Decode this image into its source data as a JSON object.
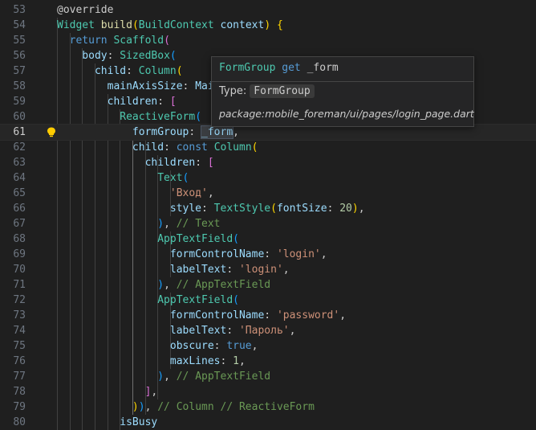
{
  "editor": {
    "active_line": 61,
    "lines": [
      {
        "n": "53",
        "t": [
          [
            "@override",
            "t-ann"
          ]
        ]
      },
      {
        "n": "54",
        "t": [
          [
            "Widget",
            "t-type"
          ],
          [
            " ",
            ""
          ],
          [
            "build",
            "t-fn"
          ],
          [
            "(",
            "t-b1"
          ],
          [
            "BuildContext",
            "t-type"
          ],
          [
            " ",
            ""
          ],
          [
            "context",
            "t-var"
          ],
          [
            ")",
            "t-b1"
          ],
          [
            " ",
            ""
          ],
          [
            "{",
            "t-b1"
          ]
        ]
      },
      {
        "n": "55",
        "t": [
          [
            "  return",
            "t-kw"
          ],
          [
            " ",
            ""
          ],
          [
            "Scaffold",
            "t-type"
          ],
          [
            "(",
            "t-b2"
          ]
        ]
      },
      {
        "n": "56",
        "t": [
          [
            "    body",
            "t-var"
          ],
          [
            ": ",
            "t-punc"
          ],
          [
            "SizedBox",
            "t-type"
          ],
          [
            "(",
            "t-b3"
          ]
        ]
      },
      {
        "n": "57",
        "t": [
          [
            "      child",
            "t-var"
          ],
          [
            ": ",
            "t-punc"
          ],
          [
            "Column",
            "t-type"
          ],
          [
            "(",
            "t-b1"
          ]
        ]
      },
      {
        "n": "58",
        "t": [
          [
            "        mainAxisSize",
            "t-var"
          ],
          [
            ": ",
            "t-punc"
          ],
          [
            "Mai",
            "t-var"
          ]
        ]
      },
      {
        "n": "59",
        "t": [
          [
            "        children",
            "t-var"
          ],
          [
            ": ",
            "t-punc"
          ],
          [
            "[",
            "t-b2"
          ]
        ]
      },
      {
        "n": "60",
        "t": [
          [
            "          ReactiveForm",
            "t-type"
          ],
          [
            "(",
            "t-b3"
          ]
        ]
      },
      {
        "n": "61",
        "t": [
          [
            "            formGroup",
            "t-var"
          ],
          [
            ": ",
            "t-punc"
          ],
          [
            "_form",
            "t-hl"
          ],
          [
            ",",
            "t-punc"
          ]
        ]
      },
      {
        "n": "62",
        "t": [
          [
            "            child",
            "t-var"
          ],
          [
            ": ",
            "t-punc"
          ],
          [
            "const",
            "t-kw"
          ],
          [
            " ",
            ""
          ],
          [
            "Column",
            "t-type"
          ],
          [
            "(",
            "t-b1"
          ]
        ]
      },
      {
        "n": "63",
        "t": [
          [
            "              children",
            "t-var"
          ],
          [
            ": ",
            "t-punc"
          ],
          [
            "[",
            "t-b2"
          ]
        ]
      },
      {
        "n": "64",
        "t": [
          [
            "                Text",
            "t-type"
          ],
          [
            "(",
            "t-b3"
          ]
        ]
      },
      {
        "n": "65",
        "t": [
          [
            "                  'Вход'",
            "t-str"
          ],
          [
            ",",
            "t-punc"
          ]
        ]
      },
      {
        "n": "66",
        "t": [
          [
            "                  style",
            "t-var"
          ],
          [
            ": ",
            "t-punc"
          ],
          [
            "TextStyle",
            "t-type"
          ],
          [
            "(",
            "t-b1"
          ],
          [
            "fontSize",
            "t-var"
          ],
          [
            ": ",
            "t-punc"
          ],
          [
            "20",
            "t-num"
          ],
          [
            ")",
            "t-b1"
          ],
          [
            ",",
            "t-punc"
          ]
        ]
      },
      {
        "n": "67",
        "t": [
          [
            "                ",
            "t-punc"
          ],
          [
            ")",
            "t-b3"
          ],
          [
            ", ",
            "t-punc"
          ],
          [
            "// Text",
            "t-com"
          ]
        ]
      },
      {
        "n": "68",
        "t": [
          [
            "                AppTextField",
            "t-type"
          ],
          [
            "(",
            "t-b3"
          ]
        ]
      },
      {
        "n": "69",
        "t": [
          [
            "                  formControlName",
            "t-var"
          ],
          [
            ": ",
            "t-punc"
          ],
          [
            "'login'",
            "t-str"
          ],
          [
            ",",
            "t-punc"
          ]
        ]
      },
      {
        "n": "70",
        "t": [
          [
            "                  labelText",
            "t-var"
          ],
          [
            ": ",
            "t-punc"
          ],
          [
            "'login'",
            "t-str"
          ],
          [
            ",",
            "t-punc"
          ]
        ]
      },
      {
        "n": "71",
        "t": [
          [
            "                ",
            "t-punc"
          ],
          [
            ")",
            "t-b3"
          ],
          [
            ", ",
            "t-punc"
          ],
          [
            "// AppTextField",
            "t-com"
          ]
        ]
      },
      {
        "n": "72",
        "t": [
          [
            "                AppTextField",
            "t-type"
          ],
          [
            "(",
            "t-b3"
          ]
        ]
      },
      {
        "n": "73",
        "t": [
          [
            "                  formControlName",
            "t-var"
          ],
          [
            ": ",
            "t-punc"
          ],
          [
            "'password'",
            "t-str"
          ],
          [
            ",",
            "t-punc"
          ]
        ]
      },
      {
        "n": "74",
        "t": [
          [
            "                  labelText",
            "t-var"
          ],
          [
            ": ",
            "t-punc"
          ],
          [
            "'Пароль'",
            "t-str"
          ],
          [
            ",",
            "t-punc"
          ]
        ]
      },
      {
        "n": "75",
        "t": [
          [
            "                  obscure",
            "t-var"
          ],
          [
            ": ",
            "t-punc"
          ],
          [
            "true",
            "t-kw"
          ],
          [
            ",",
            "t-punc"
          ]
        ]
      },
      {
        "n": "76",
        "t": [
          [
            "                  maxLines",
            "t-var"
          ],
          [
            ": ",
            "t-punc"
          ],
          [
            "1",
            "t-num"
          ],
          [
            ",",
            "t-punc"
          ]
        ]
      },
      {
        "n": "77",
        "t": [
          [
            "                ",
            "t-punc"
          ],
          [
            ")",
            "t-b3"
          ],
          [
            ", ",
            "t-punc"
          ],
          [
            "// AppTextField",
            "t-com"
          ]
        ]
      },
      {
        "n": "78",
        "t": [
          [
            "              ",
            "t-punc"
          ],
          [
            "]",
            "t-b2"
          ],
          [
            ",",
            "t-punc"
          ]
        ]
      },
      {
        "n": "79",
        "t": [
          [
            "            ",
            "t-punc"
          ],
          [
            ")",
            "t-b1"
          ],
          [
            ")",
            "t-b3"
          ],
          [
            ", ",
            "t-punc"
          ],
          [
            "// Column // ReactiveForm",
            "t-com"
          ]
        ]
      },
      {
        "n": "80",
        "t": [
          [
            "          isBusy",
            "t-var"
          ]
        ]
      }
    ]
  },
  "tooltip": {
    "sig_name": "FormGroup",
    "sig_kw": "get",
    "sig_var": "_form",
    "type_label": "Type:",
    "type_value": "FormGroup",
    "package": "package:mobile_foreman/ui/pages/login_page.dart"
  }
}
